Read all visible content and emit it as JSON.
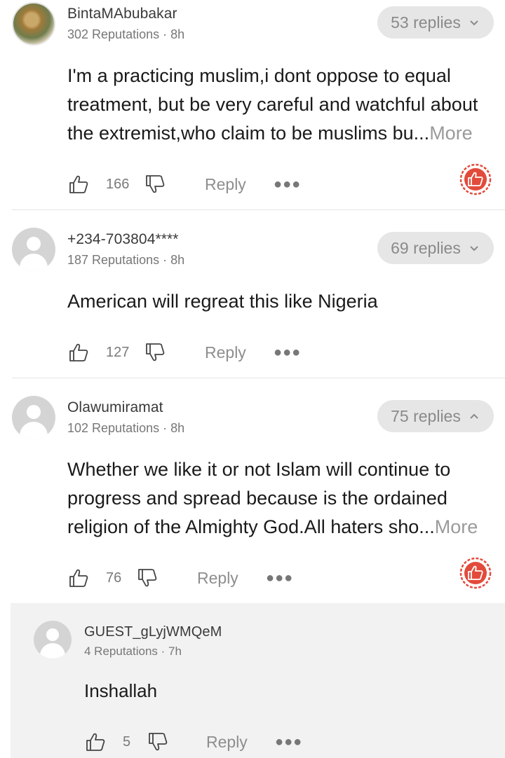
{
  "comments": [
    {
      "username": "BintaMAbubakar",
      "reputation": "302 Reputations",
      "time": "8h",
      "replies": "53 replies",
      "text": "I'm a practicing muslim,i dont oppose to equal treatment, but be very careful and watchful about the extremist,who claim to be muslims bu...",
      "more": "More",
      "likes": "166",
      "reply_label": "Reply"
    },
    {
      "username": "+234-703804****",
      "reputation": "187 Reputations",
      "time": "8h",
      "replies": "69 replies",
      "text": "American will regreat this like Nigeria",
      "more": "",
      "likes": "127",
      "reply_label": "Reply"
    },
    {
      "username": "Olawumiramat",
      "reputation": "102 Reputations",
      "time": "8h",
      "replies": "75 replies",
      "text": "Whether we like it or not Islam will continue to progress and spread because is the ordained religion of the Almighty God.All haters sho...",
      "more": "More",
      "likes": "76",
      "reply_label": "Reply"
    }
  ],
  "nested_reply": {
    "username": "GUEST_gLyjWMQeM",
    "reputation": "4 Reputations",
    "time": "7h",
    "text": "Inshallah",
    "likes": "5",
    "reply_label": "Reply"
  },
  "icons": {
    "like": "thumbs-up-icon",
    "dislike": "thumbs-down-icon",
    "more": "more-dots-icon",
    "hot": "hot-comment-badge-icon",
    "chevron_down": "chevron-down-icon",
    "chevron_up": "chevron-up-icon"
  },
  "colors": {
    "badge_red": "#e24b3b",
    "more_link": "#9a9a9a"
  }
}
